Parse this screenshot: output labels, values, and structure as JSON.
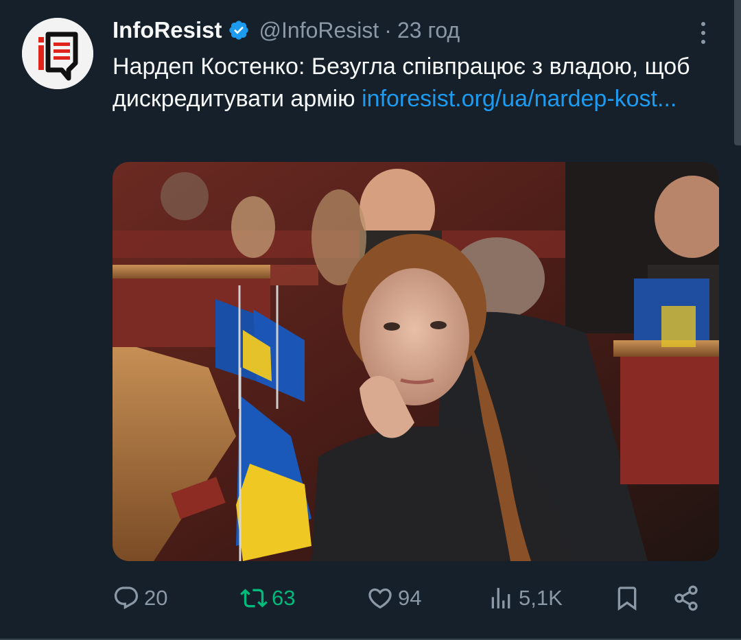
{
  "tweet": {
    "display_name": "InfoResist",
    "handle": "@InfoResist",
    "separator": "·",
    "time": "23 год",
    "text": "Нардеп Костенко: Безугла співпрацює з владою, щоб дискредитувати армію ",
    "link": "inforesist.org/ua/nardep-kost..."
  },
  "actions": {
    "replies": "20",
    "retweets": "63",
    "likes": "94",
    "views": "5,1K"
  },
  "colors": {
    "background": "#15202b",
    "text": "#f7f9f9",
    "secondary": "#8b98a5",
    "link": "#1d9bf0",
    "retweet_active": "#00ba7c",
    "verified": "#1d9bf0",
    "brand_red": "#e0241c"
  },
  "icons": {
    "avatar": "inforesist-logo",
    "verified": "verified-badge-icon",
    "more": "more-options-icon",
    "reply": "reply-icon",
    "retweet": "retweet-icon",
    "like": "heart-icon",
    "views": "views-icon",
    "bookmark": "bookmark-icon",
    "share": "share-icon"
  }
}
